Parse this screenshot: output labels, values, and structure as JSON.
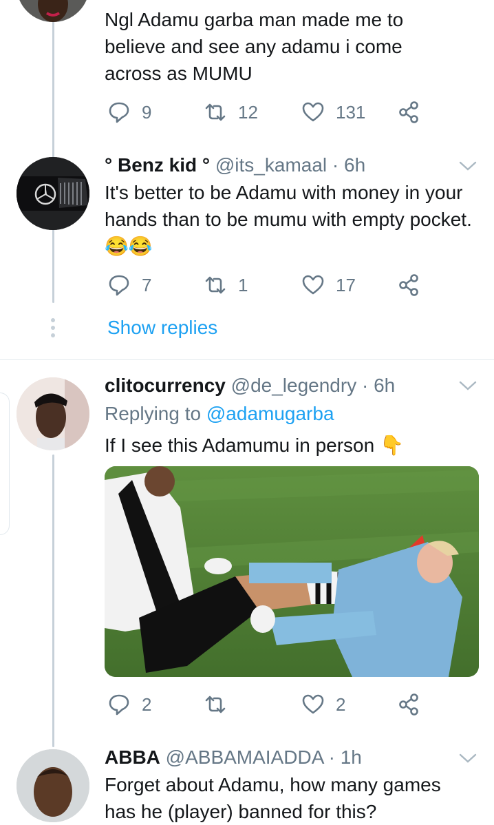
{
  "tweets": [
    {
      "text": "Ngl Adamu garba man made me to believe and see any adamu i come across as MUMU",
      "replies": "9",
      "retweets": "12",
      "likes": "131"
    },
    {
      "name": "° Benz kid °",
      "handle": "@its_kamaal",
      "time": "· 6h",
      "text": "It's better to be Adamu with money in your hands than to be mumu with empty pocket. 😂😂",
      "replies": "7",
      "retweets": "1",
      "likes": "17",
      "show_replies": "Show replies"
    },
    {
      "name": "clitocurrency",
      "handle": "@de_legendry",
      "time": "· 6h",
      "replying_prefix": "Replying to",
      "replying_to": "@adamugarba",
      "text": "If I see this Adamumu in person 👇",
      "replies": "2",
      "retweets": "",
      "likes": "2"
    },
    {
      "name": "ABBA",
      "handle": "@ABBAMAIADDA",
      "time": "· 1h",
      "text": "Forget about Adamu, how many games has he (player) banned for this?"
    }
  ],
  "colors": {
    "accent": "#1da1f2",
    "secondary": "#657786",
    "thread": "#c6d0d8"
  }
}
